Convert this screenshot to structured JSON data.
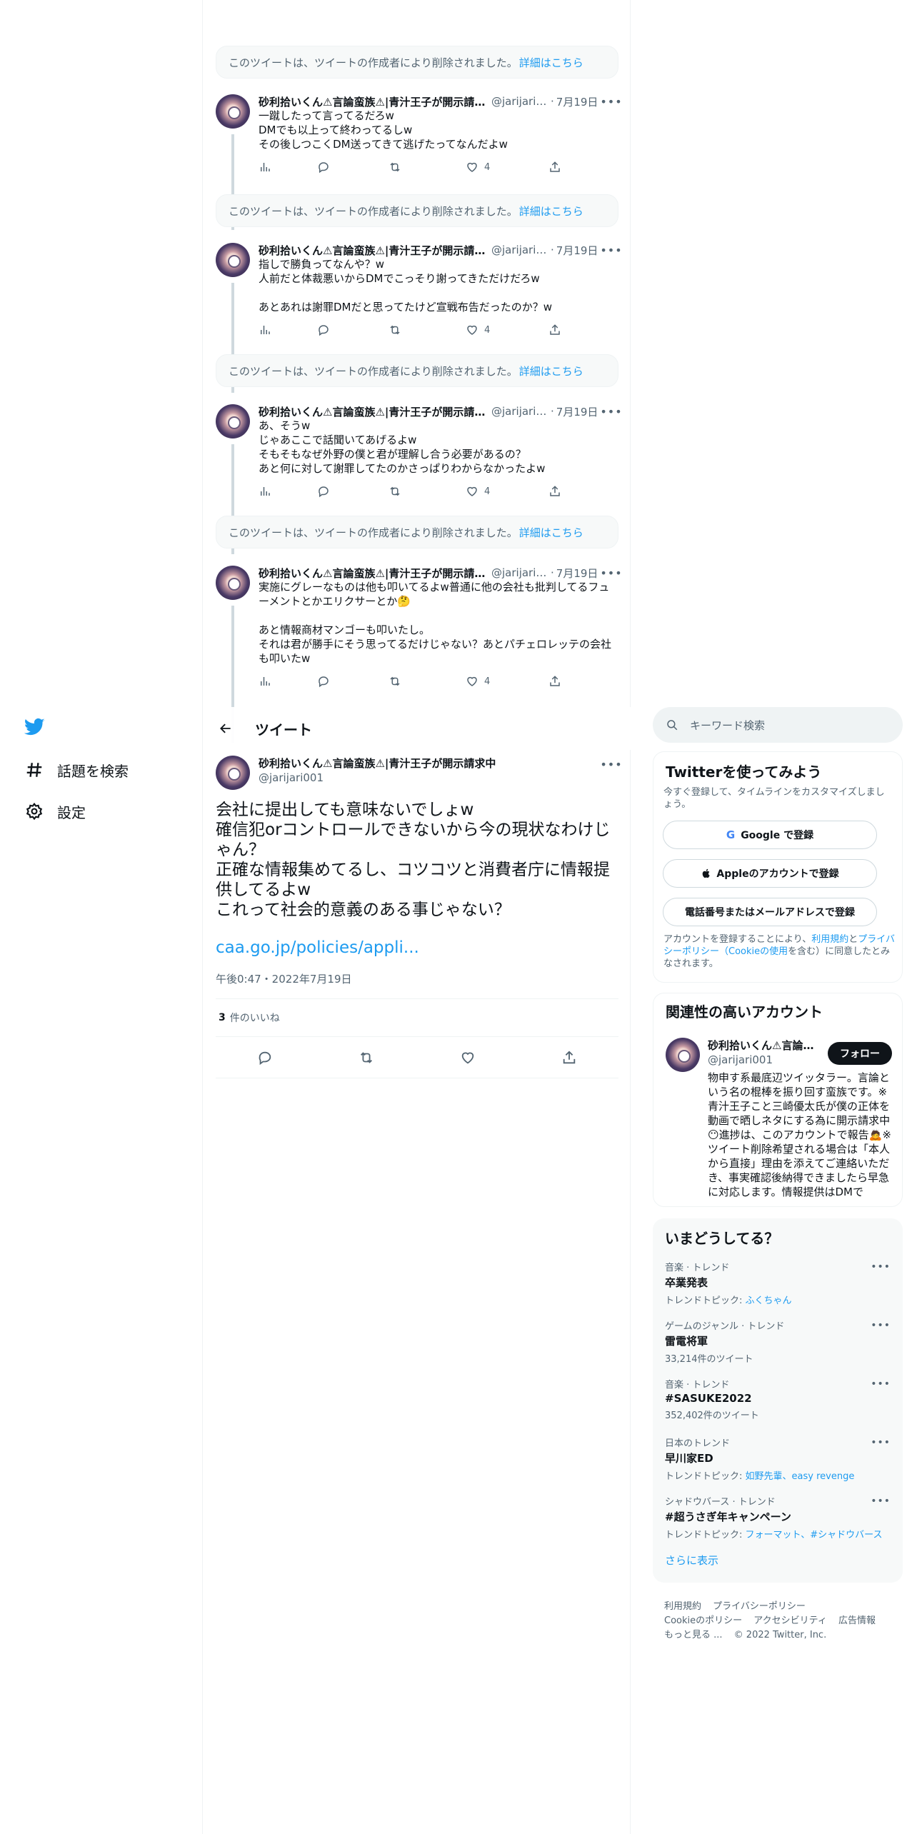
{
  "nav": {
    "items": [
      {
        "label": "話題を検索"
      },
      {
        "label": "設定"
      }
    ]
  },
  "deleted_notice": {
    "text": "このツイートは、ツイートの作成者により削除されました。",
    "link": "詳細はこちら"
  },
  "thread": [
    {
      "name": "砂利拾いくん⚠言論蛮族⚠|青汁王子が開示請求中",
      "handle": "@jarijari0...",
      "date": "7月19日",
      "text": "一蹴したって言ってるだろw\nDMでも以上って終わってるしw\nその後しつこくDM送ってきて逃げたってなんだよw",
      "likes": "4"
    },
    {
      "name": "砂利拾いくん⚠言論蛮族⚠|青汁王子が開示請求中",
      "handle": "@jarijari0...",
      "date": "7月19日",
      "text": "指しで勝負ってなんや？w\n人前だと体裁悪いからDMでこっそり謝ってきただけだろw\n\nあとあれは謝罪DMだと思ってたけど宣戦布告だったのか？w",
      "likes": "4"
    },
    {
      "name": "砂利拾いくん⚠言論蛮族⚠|青汁王子が開示請求中",
      "handle": "@jarijari0...",
      "date": "7月19日",
      "text": "あ、そうw\nじゃあここで話聞いてあげるよw\nそもそもなぜ外野の僕と君が理解し合う必要があるの？\nあと何に対して謝罪してたのかさっぱりわからなかったよw",
      "likes": "4"
    },
    {
      "name": "砂利拾いくん⚠言論蛮族⚠|青汁王子が開示請求中",
      "handle": "@jarijari0...",
      "date": "7月19日",
      "text": "実施にグレーなものは他も叩いてるよw普通に他の会社も批判してるフューメントとかエリクサーとか🤔\n\nあと情報商材マンゴーも叩いたし。\nそれは君が勝手にそう思ってるだけじゃない？あとパチェロレッテの会社も叩いたw",
      "likes": "4"
    }
  ],
  "header": {
    "title": "ツイート"
  },
  "focus": {
    "name": "砂利拾いくん⚠言論蛮族⚠|青汁王子が開示請求中",
    "handle": "@jarijari001",
    "text": "会社に提出しても意味ないでしょw\n確信犯orコントロールできないから今の現状なわけじゃん？\n正確な情報集めてるし、コツコツと消費者庁に情報提供してるよw\nこれって社会的意義のある事じゃない？",
    "link": "caa.go.jp/policies/appli...",
    "time": "午後0:47・2022年7月19日",
    "like_count": "3",
    "like_label": "件のいいね"
  },
  "search": {
    "placeholder": "キーワード検索"
  },
  "signup": {
    "title": "Twitterを使ってみよう",
    "sub": "今すぐ登録して、タイムラインをカスタマイズしましょう。",
    "google": "Google で登録",
    "apple": "Appleのアカウントで登録",
    "phone": "電話番号またはメールアドレスで登録",
    "legal_pre": "アカウントを登録することにより、",
    "legal_terms": "利用規約",
    "legal_and": "と",
    "legal_privacy": "プライバシーポリシー",
    "legal_cookie": "（Cookieの使用",
    "legal_post": "を含む）に同意したとみなされます。"
  },
  "related": {
    "title": "関連性の高いアカウント",
    "name": "砂利拾いくん⚠言論蛮族⚠|青汁王子が開示請求中",
    "handle": "@jarijari001",
    "follow": "フォロー",
    "bio": "物申す系最底辺ツイッタラー。言論という名の棍棒を振り回す蛮族です。※青汁王子こと三崎優太氏が僕の正体を動画で晒しネタにする為に開示請求中😶進捗は、このアカウントで報告🙇※ツイート削除希望される場合は「本人から直接」理由を添えてご連絡いただき、事実確認後納得できましたら早急に対応します。情報提供はDMで"
  },
  "trends": {
    "title": "いまどうしてる？",
    "items": [
      {
        "context": "音楽 · トレンド",
        "name": "卒業発表",
        "sub_prefix": "トレンドトピック: ",
        "sub_link": "ふくちゃん"
      },
      {
        "context": "ゲームのジャンル · トレンド",
        "name": "雷電将軍",
        "sub_prefix": "33,214件のツイート",
        "sub_link": ""
      },
      {
        "context": "音楽 · トレンド",
        "name": "#SASUKE2022",
        "sub_prefix": "352,402件のツイート",
        "sub_link": ""
      },
      {
        "context": "日本のトレンド",
        "name": "早川家ED",
        "sub_prefix": "トレンドトピック: ",
        "sub_link": "如野先輩、easy revenge"
      },
      {
        "context": "シャドウバース · トレンド",
        "name": "#超うさぎ年キャンペーン",
        "sub_prefix": "トレンドトピック: ",
        "sub_link": "フォーマット、#シャドウバース"
      }
    ],
    "show_more": "さらに表示"
  },
  "footer": {
    "terms": "利用規約",
    "privacy": "プライバシーポリシー",
    "cookie": "Cookieのポリシー",
    "accessibility": "アクセシビリティ",
    "ads": "広告情報",
    "more": "もっと見る ...",
    "copyright": "© 2022 Twitter, Inc."
  },
  "colors": {
    "accent": "#1d9bf0",
    "text": "#0f1419",
    "muted": "#536471",
    "border": "#eff3f4"
  }
}
